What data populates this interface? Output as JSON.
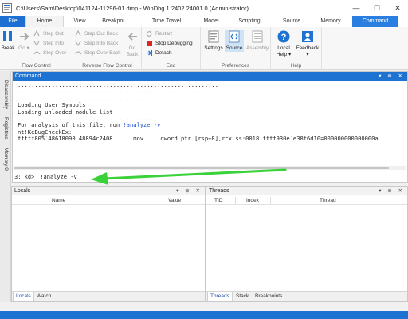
{
  "window": {
    "title": "C:\\Users\\Sam\\Desktop\\041124-11296-01.dmp - WinDbg 1.2402.24001.0 (Administrator)",
    "minimize": "—",
    "maximize": "☐",
    "close": "✕"
  },
  "ribbon": {
    "tabs": {
      "file": "File",
      "home": "Home",
      "view": "View",
      "breakpoints": "Breakpoi...",
      "time_travel": "Time Travel",
      "model": "Model",
      "scripting": "Scripting",
      "source": "Source",
      "memory": "Memory",
      "command": "Command"
    },
    "flow_control": {
      "label": "Flow Control",
      "break": "Break",
      "go": "Go",
      "step_out": "Step Out",
      "step_into": "Step Into",
      "step_over": "Step Over"
    },
    "reverse_flow": {
      "label": "Reverse Flow Control",
      "step_out_back": "Step Out Back",
      "step_into_back": "Step Into Back",
      "step_over_back": "Step Over Back",
      "go_back_line1": "Go",
      "go_back_line2": "Back"
    },
    "end": {
      "label": "End",
      "restart": "Restart",
      "stop_debugging": "Stop Debugging",
      "detach": "Detach"
    },
    "preferences": {
      "label": "Preferences",
      "settings": "Settings",
      "source": "Source",
      "assembly": "Assembly"
    },
    "help": {
      "label": "Help",
      "local_help_line1": "Local",
      "local_help_line2": "Help ▾",
      "feedback_line1": "Feedback",
      "feedback_line2": "▾"
    }
  },
  "side_tabs": {
    "disassembly": "Disassembly",
    "registers": "Registers",
    "memory0": "Memory 0"
  },
  "command_window": {
    "title": "Command",
    "pane_controls": "▾ ⊕ ✕",
    "lines": [
      "...........................................................",
      "...........................................................",
      "......................................",
      "Loading User Symbols",
      "",
      "Loading unloaded module list",
      "...........................................",
      "For analysis of this file, run ",
      "nt!KeBugCheckEx:",
      "fffff805`48618090 48894c2408      mov     qword ptr [rsp+8],rcx ss:0018:ffff930e`e38f6d10=000000000000000a"
    ],
    "analyze_link": "!analyze -v",
    "prompt": "3: kd>",
    "input_value": "!analyze -v"
  },
  "locals_pane": {
    "title": "Locals",
    "pane_controls": "▾ ⊕ ✕",
    "columns": [
      "Name",
      "Value"
    ],
    "tabs": [
      "Locals",
      "Watch"
    ]
  },
  "threads_pane": {
    "title": "Threads",
    "pane_controls": "▾ ⊕ ✕",
    "columns": [
      "TID",
      "Index",
      "Thread"
    ],
    "tabs": [
      "Threads",
      "Stack",
      "Breakpoints"
    ]
  },
  "colors": {
    "accent": "#1e73d2",
    "annotation_arrow": "#3ad13a",
    "link": "#1b4fd6"
  }
}
